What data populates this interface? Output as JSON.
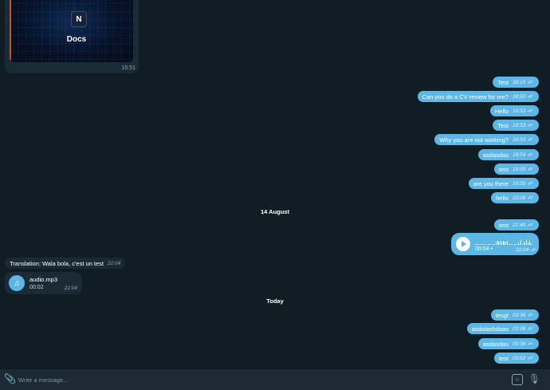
{
  "media_message": {
    "logo_letter": "N",
    "title": "Docs",
    "time": "15:51"
  },
  "outgoing_messages": [
    {
      "text": "Test",
      "time": "18:15",
      "check": "✓✓"
    },
    {
      "text": "Can you do a CV review for me?",
      "time": "18:52",
      "check": "✓✓"
    },
    {
      "text": "Hello",
      "time": "18:53",
      "check": "✓✓"
    },
    {
      "text": "Test",
      "time": "18:53",
      "check": "✓✓"
    },
    {
      "text": "Why you are not working?",
      "time": "18:53",
      "check": "✓✓"
    },
    {
      "text": "asdasdas",
      "time": "18:54",
      "check": "✓✓"
    },
    {
      "text": "test",
      "time": "18:59",
      "check": "✓✓"
    },
    {
      "text": "are you there",
      "time": "18:59",
      "check": "✓✓"
    },
    {
      "text": "hello",
      "time": "23:08",
      "check": "✓✓"
    },
    {
      "text": "test",
      "time": "21:49",
      "check": "✓✓"
    }
  ],
  "date_separators": [
    "14 August",
    "Today"
  ],
  "voice_message": {
    "duration": "00:04",
    "dot": "•",
    "time": "22:04",
    "check": "✓✓"
  },
  "incoming_translation": {
    "text": "Translation: Wala bola, c'est un test",
    "time": "22:04"
  },
  "incoming_audio": {
    "icon": "music-note-icon",
    "glyph": "♫",
    "filename": "audio.mp3",
    "duration": "00:02",
    "time": "22:04"
  },
  "today_messages": [
    {
      "text": "tesgt",
      "time": "03:36",
      "check": "✓✓"
    },
    {
      "text": "asdoiashdoas",
      "time": "03:36",
      "check": "✓✓"
    },
    {
      "text": "asdasdas",
      "time": "03:38",
      "check": "✓✓"
    },
    {
      "text": "test",
      "time": "03:52",
      "check": "✓✓"
    }
  ],
  "input_bar": {
    "placeholder": "Write a message...",
    "attach_glyph": "📎",
    "sticker_glyph": "☺",
    "mic_glyph": "🎙"
  },
  "colors": {
    "background": "#111d24",
    "outgoing_bubble": "#5cb6e6",
    "incoming_bubble": "#1b2b35"
  }
}
